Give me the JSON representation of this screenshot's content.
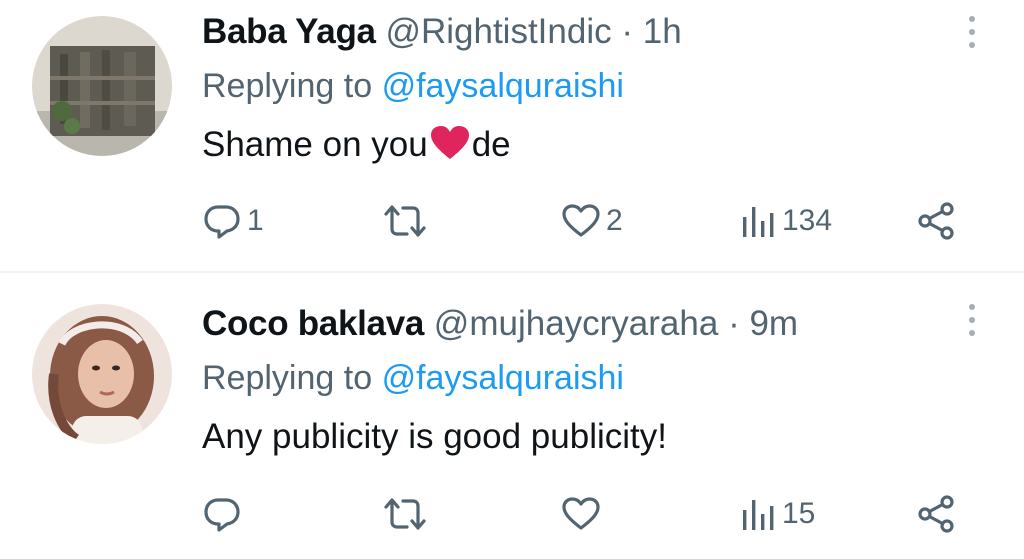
{
  "tweets": [
    {
      "name": "Baba Yaga",
      "handle": "@RightistIndic",
      "separator": "·",
      "time": "1h",
      "replying_prefix": "Replying to",
      "replying_to": "@faysalquraishi",
      "text_before": "Shame on you",
      "emoji": "red-heart-emoji",
      "text_after": "de",
      "counts": {
        "replies": "1",
        "retweets": "",
        "likes": "2",
        "views": "134"
      }
    },
    {
      "name": "Coco baklava",
      "handle": "@mujhaycryaraha",
      "separator": "·",
      "time": "9m",
      "replying_prefix": "Replying to",
      "replying_to": "@faysalquraishi",
      "text": "Any publicity is good publicity!",
      "counts": {
        "replies": "",
        "retweets": "",
        "likes": "",
        "views": "15"
      }
    }
  ],
  "icons": [
    "reply-icon",
    "retweet-icon",
    "like-icon",
    "views-icon",
    "share-icon",
    "more-options-icon"
  ],
  "colors": {
    "text": "#0f1419",
    "secondary": "#536471",
    "link": "#1d9bf0",
    "divider": "#eff3f4",
    "emoji_heart": "#e0245e"
  }
}
